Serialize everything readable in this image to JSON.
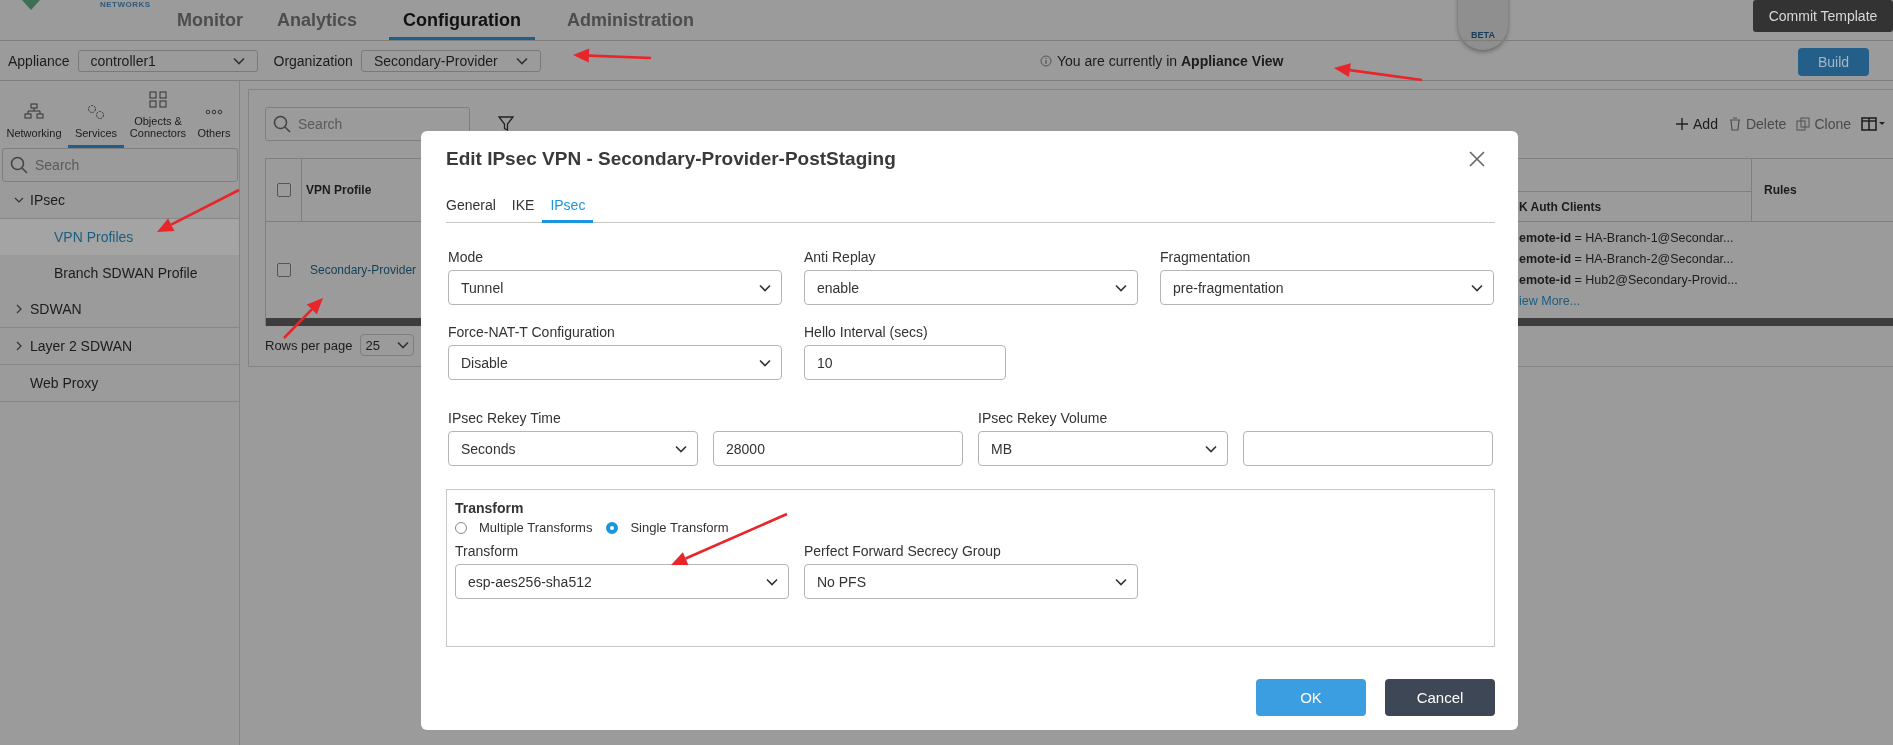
{
  "header": {
    "brand": "NETWORKS",
    "nav": [
      {
        "label": "Monitor",
        "selected": false
      },
      {
        "label": "Analytics",
        "selected": false
      },
      {
        "label": "Configuration",
        "selected": true
      },
      {
        "label": "Administration",
        "selected": false
      }
    ],
    "badge": "BETA",
    "commit_button": "Commit Template"
  },
  "context_bar": {
    "appliance": {
      "label": "Appliance",
      "value": "controller1"
    },
    "organization": {
      "label": "Organization",
      "value": "Secondary-Provider"
    },
    "notice": "You are currently in **Appliance View**",
    "build_button": "Build"
  },
  "sidebar": {
    "tabs": [
      {
        "kind": "networking",
        "label": "Networking",
        "selected": false
      },
      {
        "kind": "services",
        "label": "Services",
        "selected": true
      },
      {
        "kind": "objects",
        "label": "Objects & Connectors",
        "selected": false
      },
      {
        "kind": "others",
        "label": "Others",
        "selected": false
      }
    ],
    "search": {
      "placeholder": "Search"
    },
    "tree": [
      {
        "kind": "group",
        "label": "IPsec",
        "expanded": true,
        "children": [
          {
            "label": "VPN Profiles",
            "selected": true
          },
          {
            "label": "Branch SDWAN Profile",
            "selected": false
          }
        ]
      },
      {
        "kind": "group",
        "label": "SDWAN",
        "expanded": false
      },
      {
        "kind": "group",
        "label": "Layer 2 SDWAN",
        "expanded": false
      },
      {
        "kind": "leaf",
        "label": "Web Proxy"
      }
    ]
  },
  "main": {
    "search": {
      "placeholder": "Search"
    },
    "toolbar": [
      {
        "kind": "add",
        "label": "Add",
        "disabled": false
      },
      {
        "kind": "delete",
        "label": "Delete",
        "disabled": true
      },
      {
        "kind": "clone",
        "label": "Clone",
        "disabled": true
      }
    ],
    "table": {
      "header_checked": false,
      "columns": [
        {
          "label": "VPN Profile"
        },
        {
          "label": "K Auth Clients"
        },
        {
          "label": "Rules"
        }
      ],
      "rows": [
        {
          "checked": false,
          "vpn_profile": "Secondary-Provider",
          "auth_clients": [
            "**emote-id** = HA-Branch-1@Secondar...",
            "**emote-id** = HA-Branch-2@Secondar...",
            "**emote-id** = Hub2@Secondary-Provid..."
          ],
          "more_link": "iew More..."
        }
      ]
    },
    "rows_per_page": {
      "label": "Rows per page",
      "value": "25"
    }
  },
  "dialog": {
    "title": "Edit IPsec VPN - Secondary-Provider-PostStaging",
    "tabs": [
      {
        "label": "General",
        "selected": false
      },
      {
        "label": "IKE",
        "selected": false
      },
      {
        "label": "IPsec",
        "selected": true
      }
    ],
    "fields": [
      {
        "kind": "select",
        "label": "Mode",
        "value": "Tunnel"
      },
      {
        "kind": "select",
        "label": "Anti Replay",
        "value": "enable"
      },
      {
        "kind": "select",
        "label": "Fragmentation",
        "value": "pre-fragmentation"
      },
      {
        "kind": "select",
        "label": "Force-NAT-T Configuration",
        "value": "Disable"
      },
      {
        "kind": "input",
        "label": "Hello Interval (secs)",
        "value": "10"
      }
    ],
    "rekey": [
      {
        "label": "IPsec Rekey Time",
        "unit": "Seconds",
        "value": "28000"
      },
      {
        "label": "IPsec Rekey Volume",
        "unit": "MB"
      }
    ],
    "transform_section": {
      "title": "Transform",
      "options": [
        {
          "label": "Multiple Transforms",
          "selected": false
        },
        {
          "label": "Single Transform",
          "selected": true
        }
      ],
      "fields": [
        {
          "label": "Transform",
          "value": "esp-aes256-sha512"
        },
        {
          "label": "Perfect Forward Secrecy Group",
          "value": "No PFS"
        }
      ]
    },
    "buttons": [
      {
        "kind": "primary",
        "label": "OK"
      },
      {
        "kind": "secondary",
        "label": "Cancel"
      }
    ]
  }
}
